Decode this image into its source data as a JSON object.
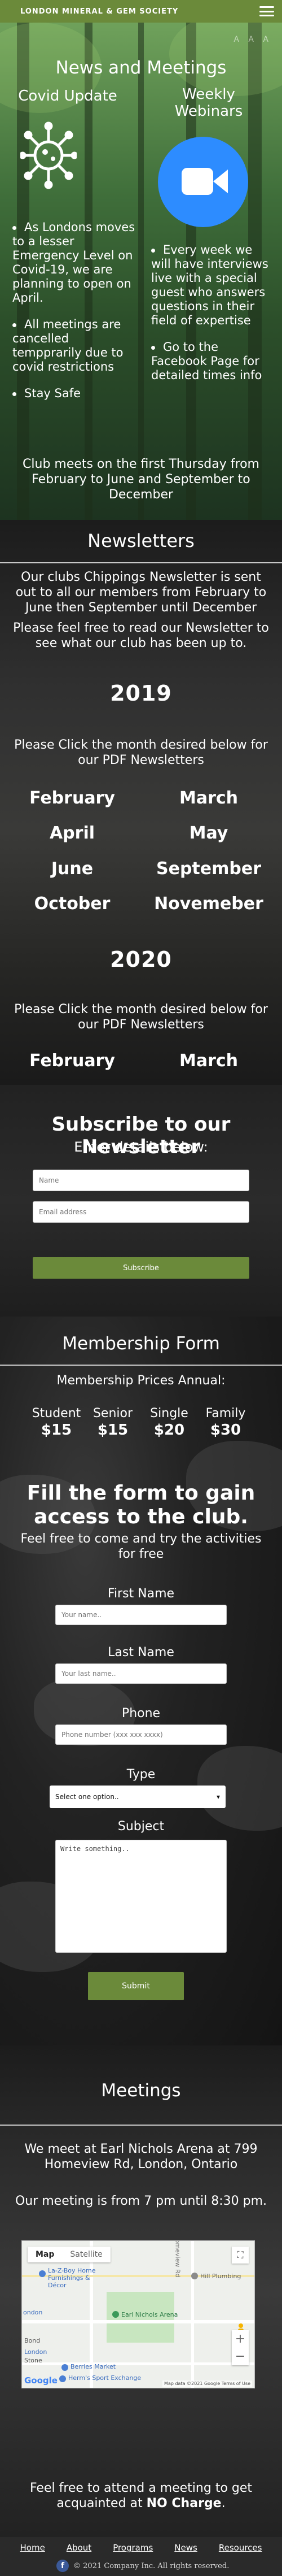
{
  "header": {
    "brand": "LONDON MINERAL & GEM SOCIETY",
    "menu_icon": "hamburger-menu-icon"
  },
  "news": {
    "accessibility_text": "A A A",
    "title": "News and Meetings",
    "covid_title": "Covid Update",
    "webinar_title": "Weekly Webinars",
    "covid_items": [
      "As Londons moves to a lesser Emergency Level on Covid-19, we are planning to open on April.",
      "All meetings are cancelled tempprarily due to covid restrictions",
      "Stay Safe"
    ],
    "webinar_items": [
      "Every week we will have interviews live with a special guest who answers questions in their field of expertise",
      "Go to the Facebook Page for detailed times info"
    ],
    "meeting_note": "Club meets on the first Thursday from February to June and September to December"
  },
  "newsletters": {
    "title": "Newsletters",
    "intro": "Our clubs Chippings Newsletter is sent out to all our members from February to June then September until December",
    "invite": "Please feel free to read our Newsletter to see what our club has been up to.",
    "year_2019": "2019",
    "prompt_2019": "Please Click the month desired below for our PDF Newsletters",
    "months_2019": [
      "February",
      "March",
      "April",
      "May",
      "June",
      "September",
      "October",
      "Novemeber"
    ],
    "year_2020": "2020",
    "prompt_2020": "Please Click the month desired below for our PDF Newsletters",
    "months_2020": [
      "February",
      "March"
    ]
  },
  "subscribe": {
    "title": "Subscribe to our Newsletter",
    "subtitle": "Enter details below:",
    "name_placeholder": "Name",
    "email_placeholder": "Email address",
    "button": "Subscribe"
  },
  "membership": {
    "title": "Membership Form",
    "prices_title": "Membership Prices Annual:",
    "prices": [
      {
        "label": "Student",
        "value": "$15"
      },
      {
        "label": "Senior",
        "value": "$15"
      },
      {
        "label": "Single",
        "value": "$20"
      },
      {
        "label": "Family",
        "value": "$30"
      }
    ],
    "fill_title": "Fill the form to gain access to the club.",
    "fill_sub": "Feel free to come and try the activities for free",
    "first_name_label": "First Name",
    "first_name_placeholder": "Your name..",
    "last_name_label": "Last Name",
    "last_name_placeholder": "Your last name..",
    "phone_label": "Phone",
    "phone_placeholder": "Phone number (xxx xxx xxxx)",
    "type_label": "Type",
    "type_selected": "Select one option..",
    "subject_label": "Subject",
    "subject_placeholder": "Write something..",
    "submit": "Submit"
  },
  "meetings": {
    "title": "Meetings",
    "location": "We meet at Earl Nichols Arena at 799 Homeview Rd, London, Ontario",
    "time": "Our meeting is from 7 pm until 8:30 pm.",
    "map": {
      "tab_map": "Map",
      "tab_satellite": "Satellite",
      "labels": [
        "La-Z-Boy Home Furnishings & Décor",
        "Hill Plumbing",
        "Earl Nichols Arena",
        "Berries Market",
        "Herm's Sport Exchange",
        "London",
        "Homeview Rd",
        "Bond",
        "Stone",
        "ondon"
      ],
      "attribution": "Map data ©2021 Google   Terms of Use",
      "logo": "Google"
    },
    "closing_1": "Feel free to attend a meeting to get acquainted at",
    "closing_2": "NO Charge",
    "closing_3": "."
  },
  "footer": {
    "links": [
      "Home",
      "About",
      "Programs",
      "News",
      "Resources"
    ],
    "copyright": "© 2021 Company Inc. All rights reserved."
  }
}
